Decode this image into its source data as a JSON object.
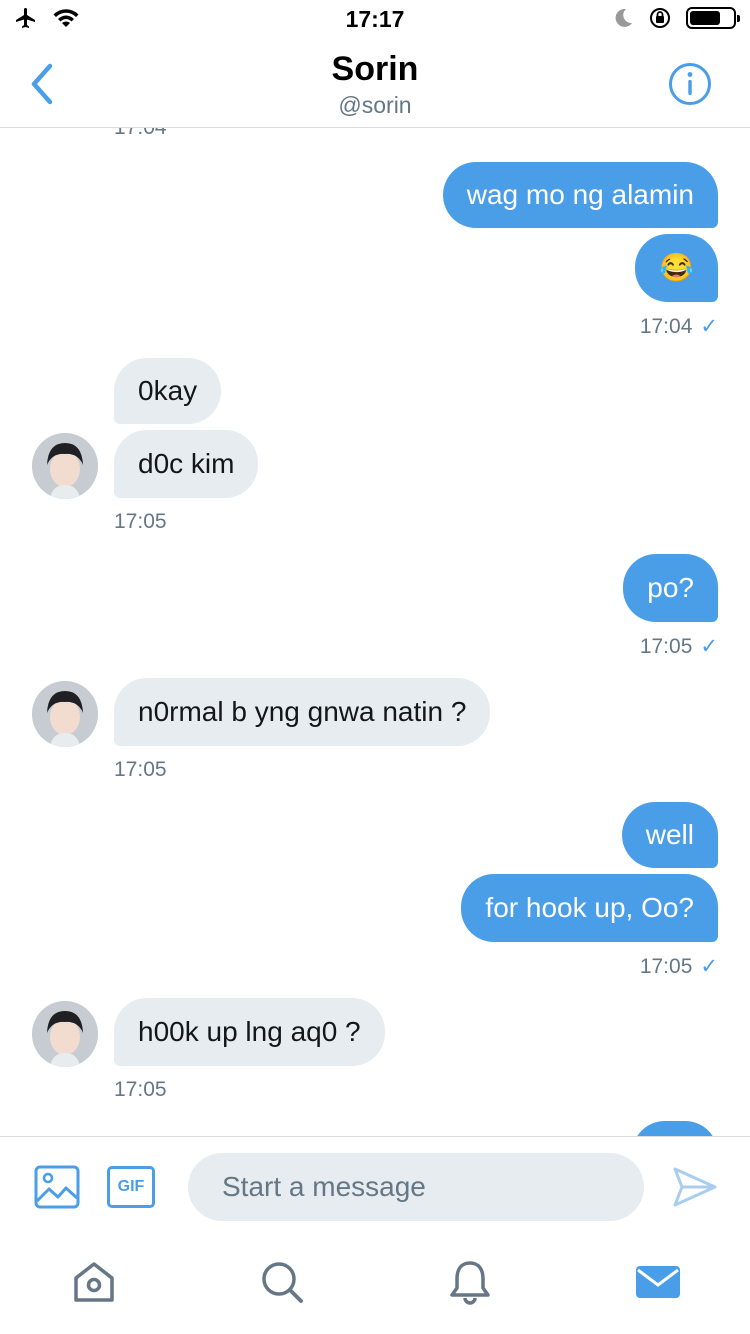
{
  "status_bar": {
    "time": "17:17"
  },
  "header": {
    "title": "Sorin",
    "handle": "@sorin"
  },
  "composer": {
    "placeholder": "Start a message",
    "gif_label": "GIF"
  },
  "messages": [
    {
      "text": "wag mo ng alamin"
    },
    {
      "text": "😂"
    },
    {
      "time": "17:04"
    },
    {
      "text": "0kay"
    },
    {
      "text": "d0c kim"
    },
    {
      "time": "17:05"
    },
    {
      "text": "po?"
    },
    {
      "time": "17:05"
    },
    {
      "text": "n0rmal b yng gnwa natin ?"
    },
    {
      "time": "17:05"
    },
    {
      "text": "well"
    },
    {
      "text": "for hook up, Oo?"
    },
    {
      "time": "17:05"
    },
    {
      "text": "h00k up lng aq0 ?"
    },
    {
      "time": "17:05"
    }
  ],
  "top_partial_time": "17:04",
  "colors": {
    "accent": "#4a9ee8",
    "incoming_bubble": "#e6ecf0",
    "secondary_text": "#657786"
  },
  "icons": [
    "airplane-icon",
    "wifi-icon",
    "moon-icon",
    "orientation-lock-icon",
    "battery-icon",
    "back-chevron-icon",
    "info-icon",
    "image-icon",
    "send-icon",
    "home-icon",
    "search-icon",
    "bell-icon",
    "mail-icon"
  ]
}
